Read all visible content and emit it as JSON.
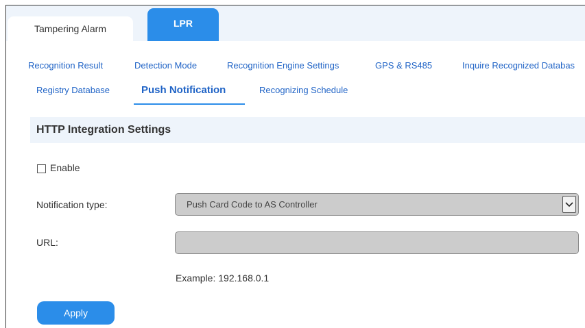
{
  "tabs": [
    {
      "label": "Tampering Alarm",
      "active": false
    },
    {
      "label": "LPR",
      "active": true
    }
  ],
  "subnav": {
    "row1": [
      "Recognition Result",
      "Detection Mode",
      "Recognition Engine Settings",
      "GPS & RS485",
      "Inquire Recognized Databas"
    ],
    "row2": [
      "Registry Database",
      "Push Notification",
      "Recognizing Schedule"
    ],
    "active": "Push Notification"
  },
  "section": {
    "title": "HTTP Integration Settings"
  },
  "form": {
    "enable_label": "Enable",
    "enable_checked": false,
    "notification_type_label": "Notification type:",
    "notification_type_value": "Push Card Code to AS Controller",
    "url_label": "URL:",
    "url_value": "",
    "url_example": "Example: 192.168.0.1"
  },
  "actions": {
    "apply_label": "Apply"
  },
  "colors": {
    "accent": "#2b8de9",
    "link": "#1f63c6",
    "header_bg": "#eef4fb",
    "disabled_field": "#cccccc"
  }
}
